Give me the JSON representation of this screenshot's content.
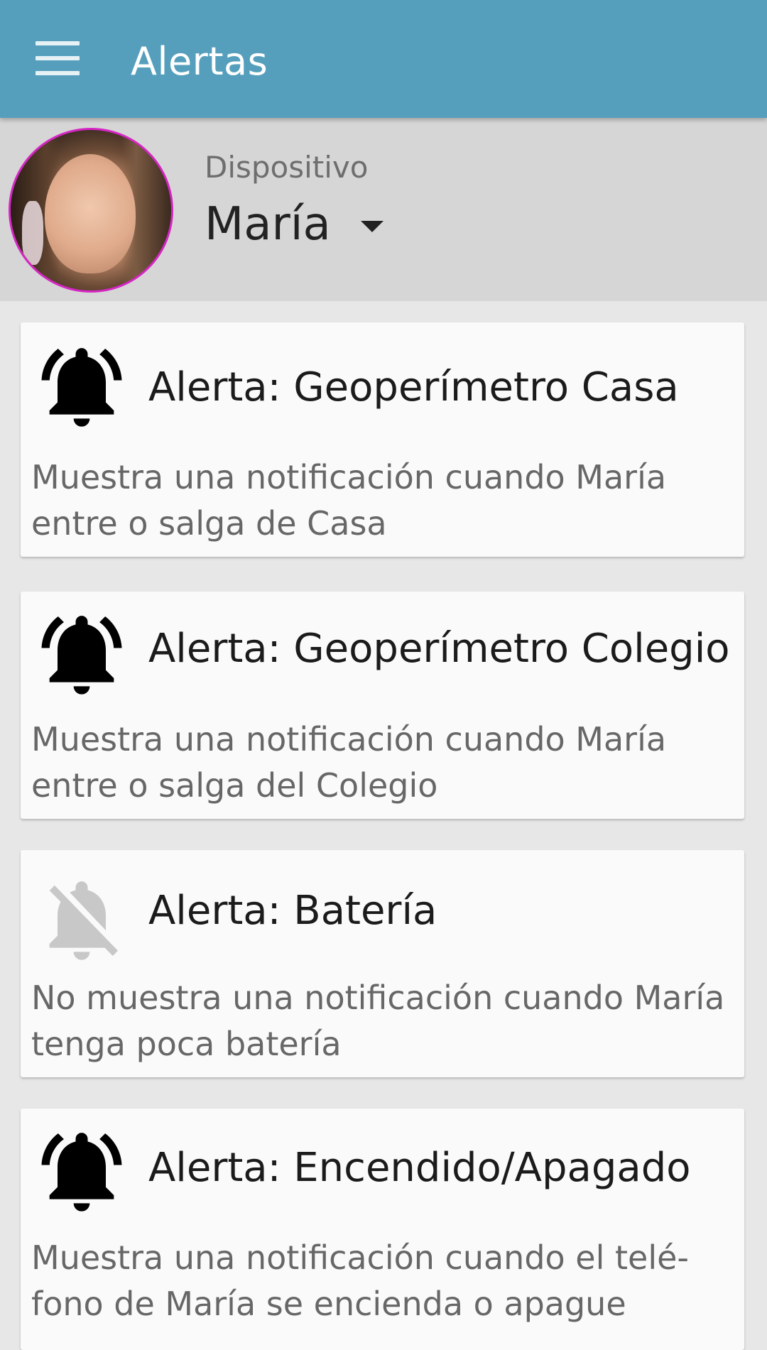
{
  "app_bar": {
    "title": "Alertas"
  },
  "device": {
    "label": "Dispositivo",
    "selected": "María"
  },
  "alerts": [
    {
      "title": "Alerta: Geoperímetro Casa",
      "description": "Muestra una notificación cuando María entre o salga de Casa",
      "enabled": true,
      "icon": "bell-ringing-icon"
    },
    {
      "title": "Alerta: Geoperímetro Colegio",
      "description": "Muestra una notificación cuando María entre o salga del Colegio",
      "enabled": true,
      "icon": "bell-ringing-icon"
    },
    {
      "title": "Alerta: Batería",
      "description": "No muestra una notificación cuando María tenga poca batería",
      "enabled": false,
      "icon": "bell-off-icon"
    },
    {
      "title": "Alerta: Encendido/Apagado",
      "description": "Muestra una notificación cuando el telé- fono de María se encienda o apague",
      "enabled": true,
      "icon": "bell-ringing-icon"
    }
  ],
  "colors": {
    "app_bar": "#559fbd",
    "header_bg": "#d6d6d6",
    "page_bg": "#e7e7e7",
    "card_bg": "#fafafa",
    "avatar_border": "#d626c5",
    "icon_enabled": "#000000",
    "icon_disabled": "#c8c8c8"
  }
}
